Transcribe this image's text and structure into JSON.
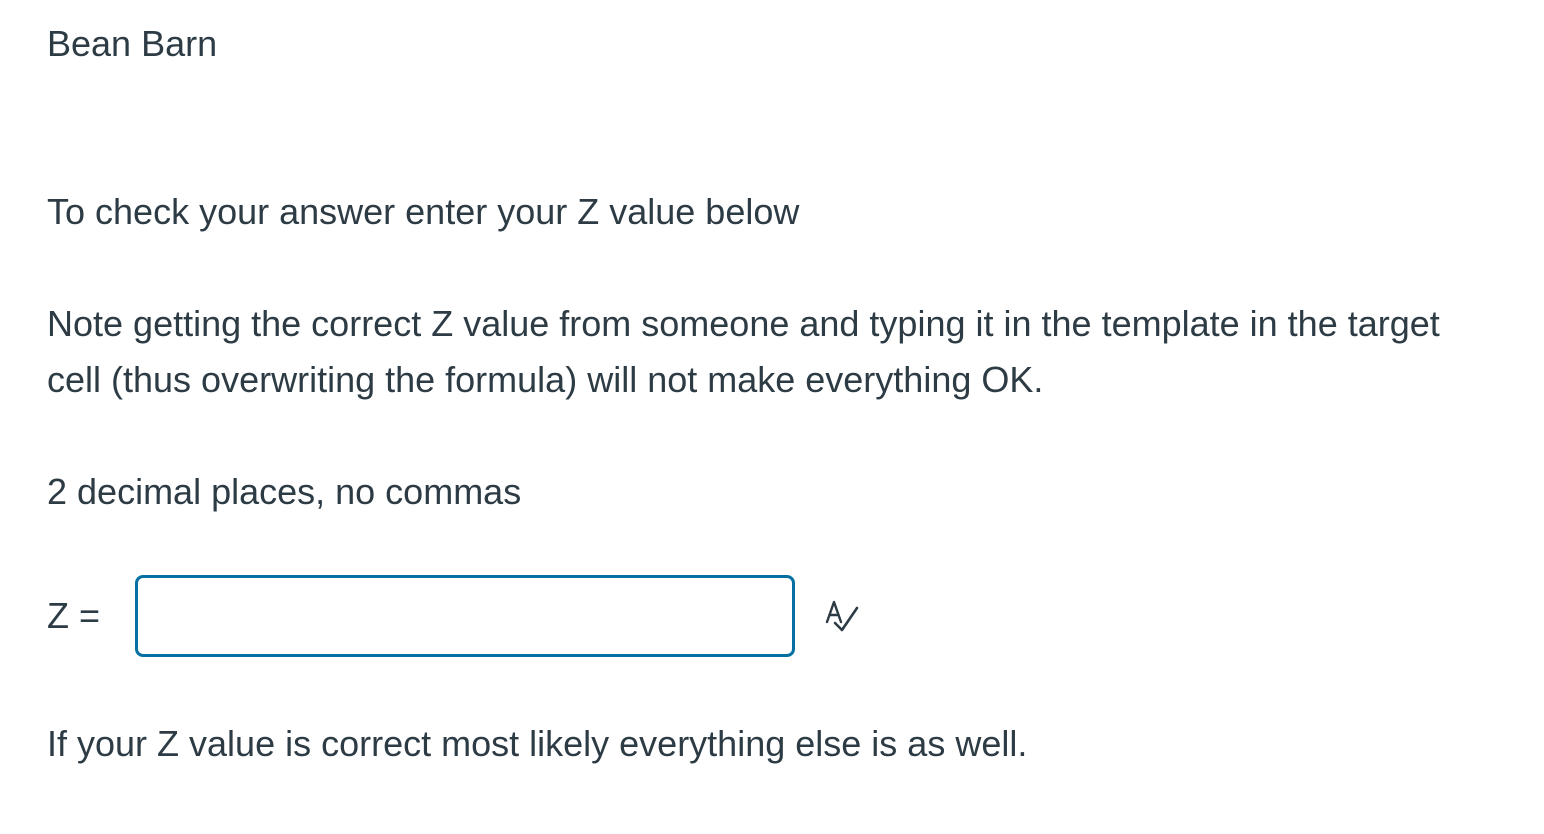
{
  "title": "Bean Barn",
  "paragraphs": {
    "check_instruction": "To check your answer enter your Z value below",
    "note": "Note getting the correct Z value from someone and typing it in the template in the target cell (thus overwriting the formula) will not make everything OK.",
    "format_hint": "2 decimal places, no commas",
    "conclusion": "If your Z value is correct most likely everything else is as well."
  },
  "answer": {
    "label": "Z =",
    "value": "",
    "placeholder": ""
  },
  "icons": {
    "spellcheck": "spell-check-icon"
  },
  "colors": {
    "text": "#2d3b45",
    "input_border": "#0770a3",
    "background": "#ffffff"
  }
}
